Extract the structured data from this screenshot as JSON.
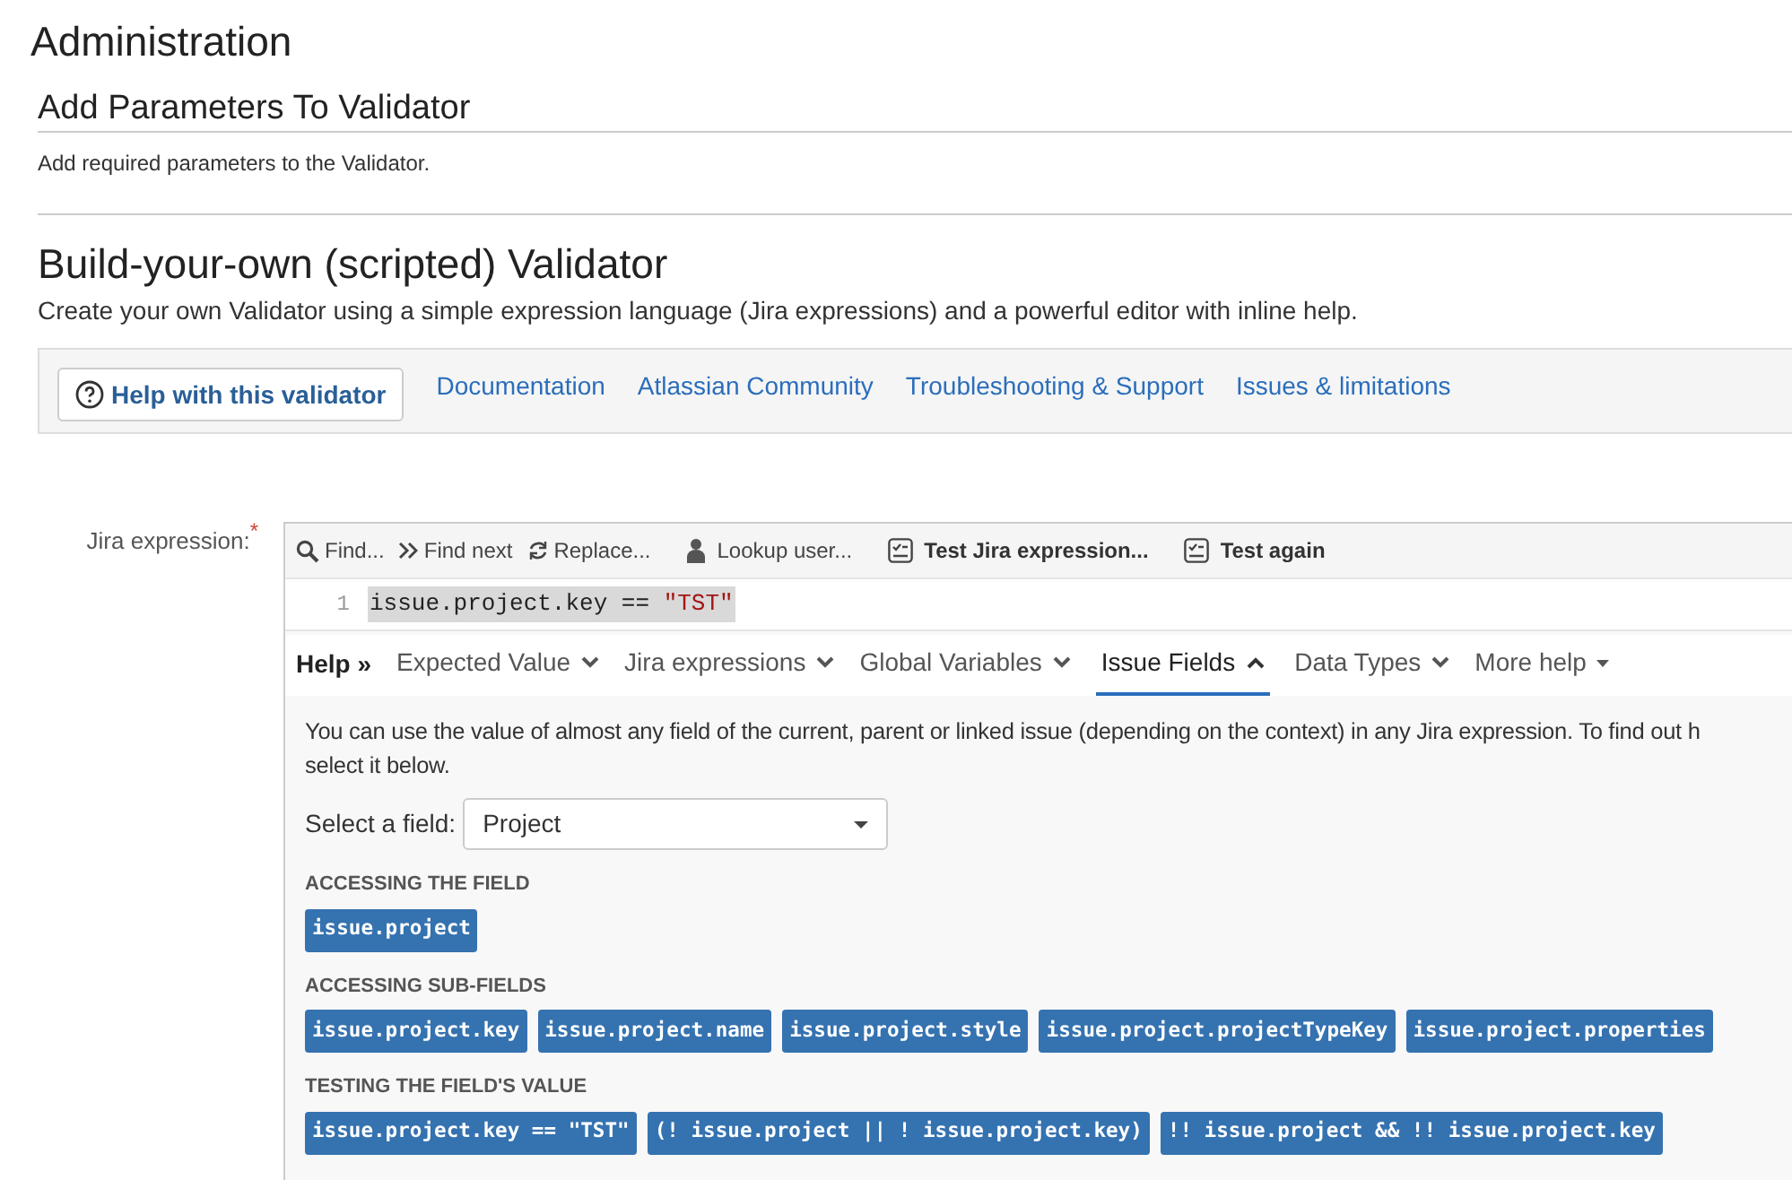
{
  "page_title": "Administration",
  "section": {
    "title": "Add Parameters To Validator",
    "description": "Add required parameters to the Validator."
  },
  "validator": {
    "title": "Build-your-own (scripted) Validator",
    "description": "Create your own Validator using a simple expression language (Jira expressions) and a powerful editor with inline help."
  },
  "help_bar": {
    "button": "Help with this validator",
    "links": [
      "Documentation",
      "Atlassian Community",
      "Troubleshooting & Support",
      "Issues & limitations"
    ]
  },
  "field": {
    "label": "Jira expression:",
    "required_mark": "*"
  },
  "editor_toolbar": [
    {
      "kind": "search",
      "label": "Find..."
    },
    {
      "kind": "next",
      "label": "Find next"
    },
    {
      "kind": "replace",
      "label": "Replace..."
    },
    {
      "kind": "user",
      "label": "Lookup user..."
    },
    {
      "kind": "test",
      "label": "Test Jira expression..."
    },
    {
      "kind": "test",
      "label": "Test again"
    }
  ],
  "code_lines": [
    {
      "number": "1",
      "tokens": [
        {
          "kind": "plain",
          "text": "issue.project.key == "
        },
        {
          "kind": "string",
          "text": "\"TST\""
        }
      ]
    }
  ],
  "help_tabs": {
    "label": "Help",
    "separator": "»",
    "tabs": [
      {
        "label": "Expected Value",
        "kind": "section",
        "selected": false,
        "expanded": false
      },
      {
        "label": "Jira expressions",
        "kind": "section",
        "selected": false,
        "expanded": false
      },
      {
        "label": "Global Variables",
        "kind": "section",
        "selected": false,
        "expanded": false
      },
      {
        "label": "Issue Fields",
        "kind": "section",
        "selected": true,
        "expanded": true
      },
      {
        "label": "Data Types",
        "kind": "section",
        "selected": false,
        "expanded": false
      },
      {
        "label": "More help",
        "kind": "menu",
        "selected": false
      }
    ]
  },
  "help_content": {
    "intro_lines": [
      "You can use the value of almost any field of the current, parent or linked issue (depending on the context) in any Jira expression. To find out h",
      "select it below."
    ],
    "select_label": "Select a field:",
    "select_value": "Project",
    "groups": [
      {
        "heading": "ACCESSING THE FIELD",
        "snippets": [
          "issue.project"
        ]
      },
      {
        "heading": "ACCESSING SUB-FIELDS",
        "snippets": [
          "issue.project.key",
          "issue.project.name",
          "issue.project.style",
          "issue.project.projectTypeKey",
          "issue.project.properties"
        ]
      },
      {
        "heading": "TESTING THE FIELD'S VALUE",
        "snippets": [
          "issue.project.key == \"TST\"",
          "(! issue.project || ! issue.project.key)",
          "!! issue.project && !! issue.project.key"
        ]
      }
    ]
  }
}
